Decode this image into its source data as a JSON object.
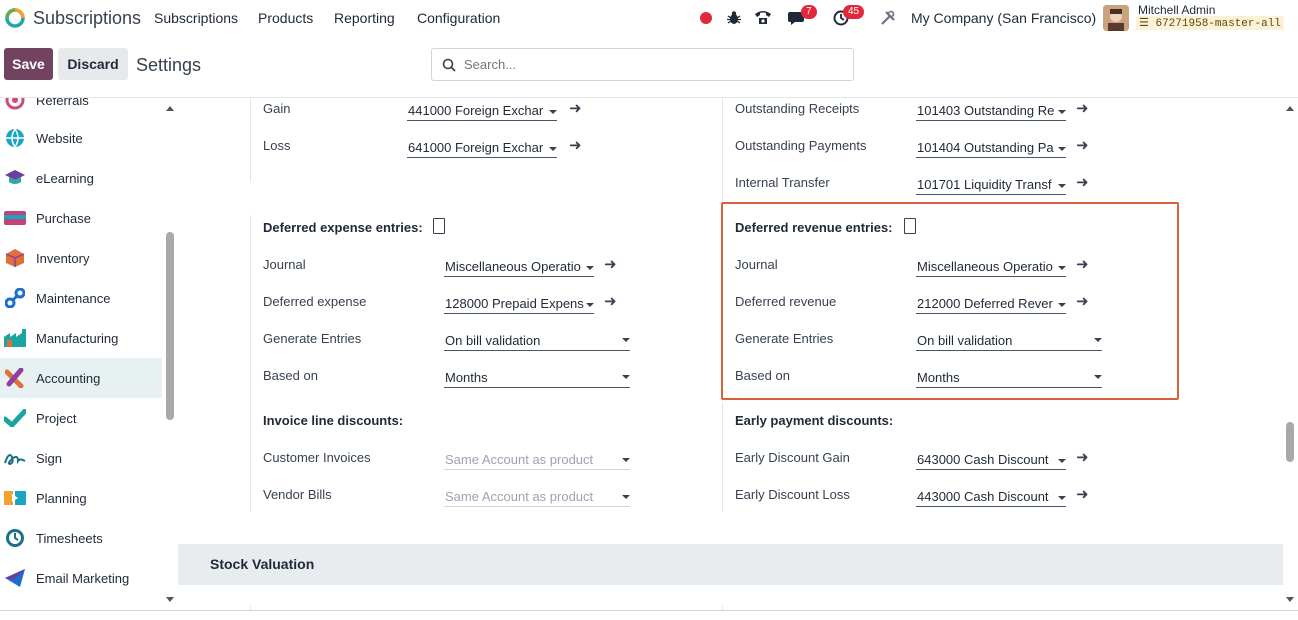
{
  "topnav": {
    "app_title": "Subscriptions",
    "menu": [
      "Subscriptions",
      "Products",
      "Reporting",
      "Configuration"
    ],
    "chat_badge": "7",
    "activity_badge": "45",
    "company": "My Company (San Francisco)",
    "user_name": "Mitchell Admin",
    "database": "67271958-master-all"
  },
  "controlbar": {
    "save_label": "Save",
    "discard_label": "Discard",
    "title": "Settings",
    "search_placeholder": "Search..."
  },
  "sidebar": {
    "items": [
      {
        "label": "Referrals",
        "icon": "referrals-icon"
      },
      {
        "label": "Website",
        "icon": "website-icon"
      },
      {
        "label": "eLearning",
        "icon": "elearning-icon"
      },
      {
        "label": "Purchase",
        "icon": "purchase-icon"
      },
      {
        "label": "Inventory",
        "icon": "inventory-icon"
      },
      {
        "label": "Maintenance",
        "icon": "maintenance-icon"
      },
      {
        "label": "Manufacturing",
        "icon": "manufacturing-icon"
      },
      {
        "label": "Accounting",
        "icon": "accounting-icon",
        "active": true
      },
      {
        "label": "Project",
        "icon": "project-icon"
      },
      {
        "label": "Sign",
        "icon": "sign-icon"
      },
      {
        "label": "Planning",
        "icon": "planning-icon"
      },
      {
        "label": "Timesheets",
        "icon": "timesheets-icon"
      },
      {
        "label": "Email Marketing",
        "icon": "email-marketing-icon"
      }
    ]
  },
  "exchange": {
    "gain_label": "Gain",
    "gain_value": "441000 Foreign Exchar",
    "loss_label": "Loss",
    "loss_value": "641000 Foreign Exchar"
  },
  "bank": {
    "receipts_label": "Outstanding Receipts",
    "receipts_value": "101403 Outstanding Re",
    "payments_label": "Outstanding Payments",
    "payments_value": "101404 Outstanding Pa",
    "transfer_label": "Internal Transfer",
    "transfer_value": "101701 Liquidity Transf"
  },
  "deferred_expense": {
    "title": "Deferred expense entries:",
    "journal_label": "Journal",
    "journal_value": "Miscellaneous Operatio",
    "account_label": "Deferred expense",
    "account_value": "128000 Prepaid Expens",
    "generate_label": "Generate Entries",
    "generate_value": "On bill validation",
    "based_label": "Based on",
    "based_value": "Months"
  },
  "deferred_revenue": {
    "title": "Deferred revenue entries:",
    "journal_label": "Journal",
    "journal_value": "Miscellaneous Operatio",
    "account_label": "Deferred revenue",
    "account_value": "212000 Deferred Rever",
    "generate_label": "Generate Entries",
    "generate_value": "On bill validation",
    "based_label": "Based on",
    "based_value": "Months"
  },
  "invoice_discounts": {
    "title": "Invoice line discounts:",
    "customer_label": "Customer Invoices",
    "customer_value": "Same Account as product",
    "vendor_label": "Vendor Bills",
    "vendor_value": "Same Account as product"
  },
  "early_payment": {
    "title": "Early payment discounts:",
    "gain_label": "Early Discount Gain",
    "gain_value": "643000 Cash Discount",
    "loss_label": "Early Discount Loss",
    "loss_value": "443000 Cash Discount"
  },
  "stock_valuation": {
    "title": "Stock Valuation"
  },
  "colors": {
    "brand": "#71435f",
    "highlight": "#d9603d",
    "badge": "#e02a3b"
  }
}
